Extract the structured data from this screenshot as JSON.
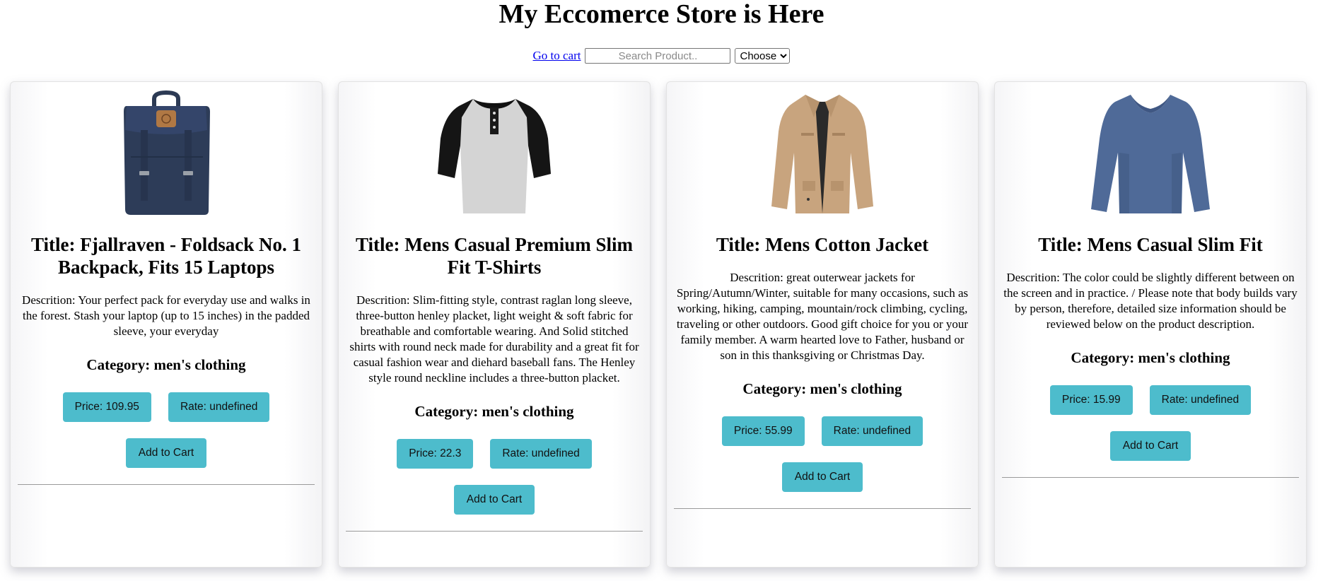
{
  "header": {
    "title": "My Eccomerce Store is Here",
    "cart_link": "Go to cart",
    "search_placeholder": "Search Product..",
    "select_value": "Choose"
  },
  "accent_color": "#4dbccc",
  "products": [
    {
      "image_icon": "backpack-image",
      "title": "Title: Fjallraven - Foldsack No. 1 Backpack, Fits 15 Laptops",
      "description": "Descrition: Your perfect pack for everyday use and walks in the forest. Stash your laptop (up to 15 inches) in the padded sleeve, your everyday",
      "category": "Category: men's clothing",
      "price": "Price: 109.95",
      "rate": "Rate: undefined",
      "add_label": "Add to Cart"
    },
    {
      "image_icon": "henley-shirt-image",
      "title": "Title: Mens Casual Premium Slim Fit T-Shirts",
      "description": "Descrition: Slim-fitting style, contrast raglan long sleeve, three-button henley placket, light weight & soft fabric for breathable and comfortable wearing. And Solid stitched shirts with round neck made for durability and a great fit for casual fashion wear and diehard baseball fans. The Henley style round neckline includes a three-button placket.",
      "category": "Category: men's clothing",
      "price": "Price: 22.3",
      "rate": "Rate: undefined",
      "add_label": "Add to Cart"
    },
    {
      "image_icon": "cotton-jacket-image",
      "title": "Title: Mens Cotton Jacket",
      "description": "Descrition: great outerwear jackets for Spring/Autumn/Winter, suitable for many occasions, such as working, hiking, camping, mountain/rock climbing, cycling, traveling or other outdoors. Good gift choice for you or your family member. A warm hearted love to Father, husband or son in this thanksgiving or Christmas Day.",
      "category": "Category: men's clothing",
      "price": "Price: 55.99",
      "rate": "Rate: undefined",
      "add_label": "Add to Cart"
    },
    {
      "image_icon": "long-sleeve-shirt-image",
      "title": "Title: Mens Casual Slim Fit",
      "description": "Descrition: The color could be slightly different between on the screen and in practice. / Please note that body builds vary by person, therefore, detailed size information should be reviewed below on the product description.",
      "category": "Category: men's clothing",
      "price": "Price: 15.99",
      "rate": "Rate: undefined",
      "add_label": "Add to Cart"
    }
  ]
}
